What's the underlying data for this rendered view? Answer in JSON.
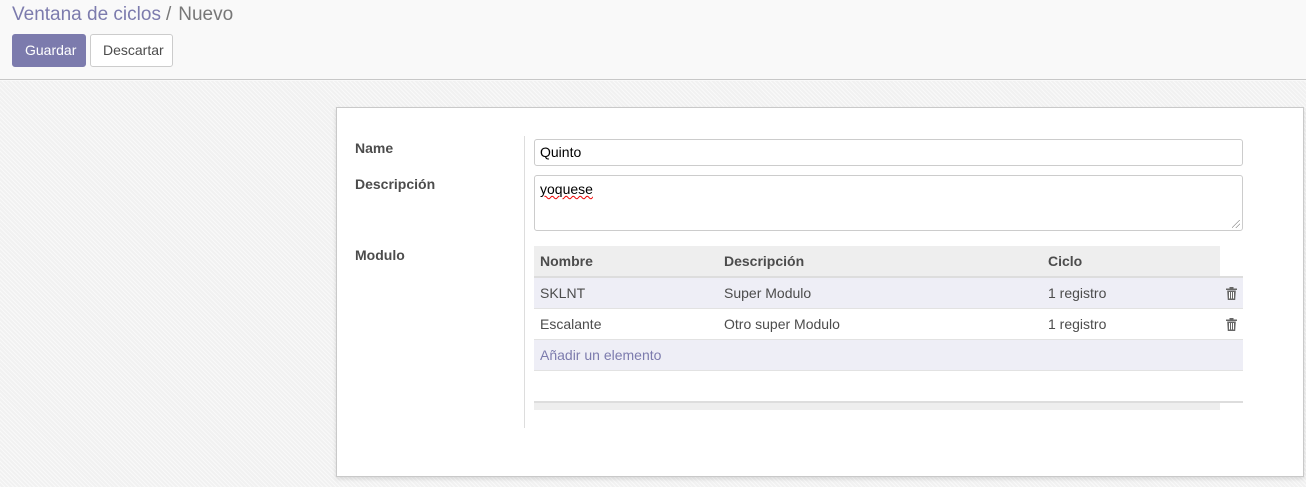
{
  "breadcrumb": {
    "parent": "Ventana de ciclos",
    "separator": "/",
    "current": "Nuevo"
  },
  "toolbar": {
    "save_label": "Guardar",
    "discard_label": "Descartar"
  },
  "form": {
    "name_label": "Name",
    "name_value": "Quinto",
    "description_label": "Descripción",
    "description_value": "yoquese",
    "modulo_label": "Modulo"
  },
  "modulo_table": {
    "columns": [
      "Nombre",
      "Descripción",
      "Ciclo"
    ],
    "rows": [
      {
        "nombre": "SKLNT",
        "descripcion": "Super Modulo",
        "ciclo": "1 registro"
      },
      {
        "nombre": "Escalante",
        "descripcion": "Otro super Modulo",
        "ciclo": "1 registro"
      }
    ],
    "add_label": "Añadir un elemento"
  },
  "colors": {
    "accent": "#7c7bad",
    "row_highlight": "#eeeef6"
  },
  "icons": {
    "delete": "trash-icon"
  }
}
